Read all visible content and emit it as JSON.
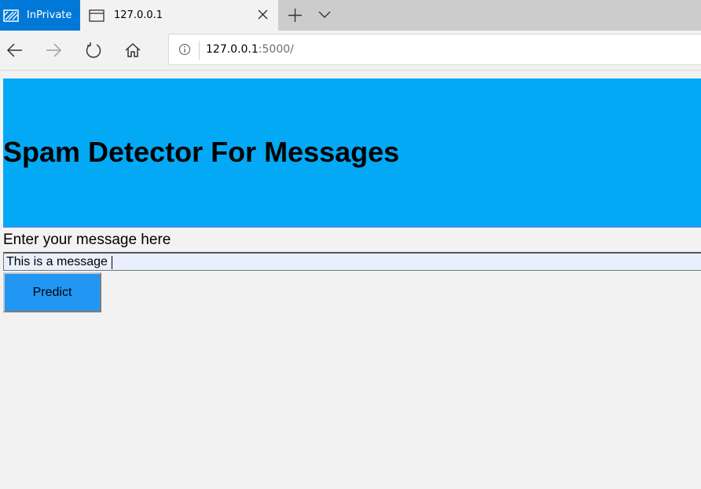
{
  "browser": {
    "inprivate_label": "InPrivate",
    "tab_title": "127.0.0.1",
    "address": {
      "host": "127.0.0.1",
      "path": ":5000/"
    }
  },
  "page": {
    "heading": "Spam Detector For Messages",
    "prompt_label": "Enter your message here",
    "message_value": "This is a message",
    "predict_label": "Predict"
  },
  "colors": {
    "header_bg": "#03a9f4",
    "button_bg": "#2196f3",
    "inprivate_bg": "#0078d7"
  },
  "icons": [
    "inprivate-icon",
    "page-icon",
    "close-icon",
    "plus-icon",
    "chevron-down-icon",
    "back-icon",
    "forward-icon",
    "refresh-icon",
    "home-icon",
    "info-icon"
  ]
}
